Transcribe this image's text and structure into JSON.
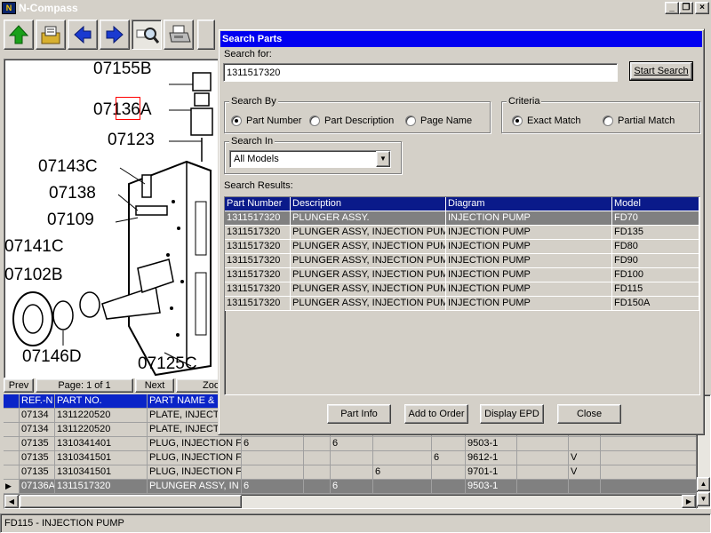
{
  "app": {
    "title": "N-Compass",
    "icon_letter": "N"
  },
  "window_buttons": {
    "minimize": "_",
    "restore": "❐",
    "close": "×"
  },
  "toolbar": [
    "up-arrow-icon",
    "folder-book-icon",
    "back-arrow-icon",
    "forward-arrow-icon",
    "search-magnifier-icon",
    "printer-icon"
  ],
  "diagram": {
    "callouts": [
      "07155B",
      "07136A",
      "07123",
      "07143C",
      "07138",
      "07109",
      "07141C",
      "07102B",
      "07146D",
      "07125C"
    ],
    "highlight": "07136A"
  },
  "navbar": {
    "prev": "Prev",
    "page": "Page: 1 of 1",
    "next": "Next",
    "zoom": "Zoo"
  },
  "grid": {
    "headers": [
      "REF.-N",
      "PART NO.",
      "PART NAME &"
    ],
    "rows": [
      [
        "07134",
        "1311220520",
        "PLATE, INJECT",
        "",
        "",
        "",
        "",
        "",
        "",
        "",
        "",
        ""
      ],
      [
        "07134",
        "1311220520",
        "PLATE, INJECT",
        "",
        "",
        "",
        "",
        "",
        "",
        "",
        "",
        ""
      ],
      [
        "07135",
        "1310341401",
        "PLUG, INJECTION F",
        "6",
        "",
        "6",
        "",
        "",
        "9503-1",
        "",
        "",
        ""
      ],
      [
        "07135",
        "1310341501",
        "PLUG, INJECTION F",
        "",
        "",
        "",
        "",
        "6",
        "9612-1",
        "",
        "V",
        ""
      ],
      [
        "07135",
        "1310341501",
        "PLUG, INJECTION F",
        "",
        "",
        "",
        "6",
        "",
        "9701-1",
        "",
        "V",
        ""
      ],
      [
        "07136A",
        "1311517320",
        "PLUNGER ASSY, IN",
        "6",
        "",
        "6",
        "",
        "",
        "9503-1",
        "",
        "",
        ""
      ]
    ],
    "selected_row": 5
  },
  "statusbar": {
    "text": "FD115 - INJECTION PUMP"
  },
  "dialog": {
    "title": "Search Parts",
    "search_for_label": "Search for:",
    "search_value": "1311517320",
    "start_search": "Start Search",
    "search_by": {
      "label": "Search By",
      "options": [
        "Part Number",
        "Part Description",
        "Page Name"
      ],
      "selected": 0
    },
    "criteria": {
      "label": "Criteria",
      "options": [
        "Exact Match",
        "Partial Match"
      ],
      "selected": 0
    },
    "search_in": {
      "label": "Search In",
      "value": "All Models"
    },
    "results_label": "Search Results:",
    "results": {
      "columns": [
        "Part Number",
        "Description",
        "Diagram",
        "Model"
      ],
      "rows": [
        [
          "1311517320",
          "PLUNGER ASSY.",
          "INJECTION PUMP",
          "FD70"
        ],
        [
          "1311517320",
          "PLUNGER ASSY, INJECTION PUMP",
          "INJECTION PUMP",
          "FD135"
        ],
        [
          "1311517320",
          "PLUNGER ASSY, INJECTION PUMP",
          "INJECTION PUMP",
          "FD80"
        ],
        [
          "1311517320",
          "PLUNGER ASSY, INJECTION PUMP",
          "INJECTION PUMP",
          "FD90"
        ],
        [
          "1311517320",
          "PLUNGER ASSY, INJECTION PUMP",
          "INJECTION PUMP",
          "FD100"
        ],
        [
          "1311517320",
          "PLUNGER ASSY, INJECTION PUMP",
          "INJECTION PUMP",
          "FD115"
        ],
        [
          "1311517320",
          "PLUNGER ASSY, INJECTION PUMP",
          "INJECTION PUMP",
          "FD150A"
        ]
      ],
      "selected": 0
    },
    "buttons": {
      "part_info": "Part Info",
      "add_to_order": "Add to Order",
      "display_epd": "Display EPD",
      "close": "Close"
    }
  },
  "colors": {
    "title_blue": "#0000f0",
    "grid_header": "#0a24c8",
    "selection": "#808080",
    "highlight_box": "#ff0000"
  }
}
